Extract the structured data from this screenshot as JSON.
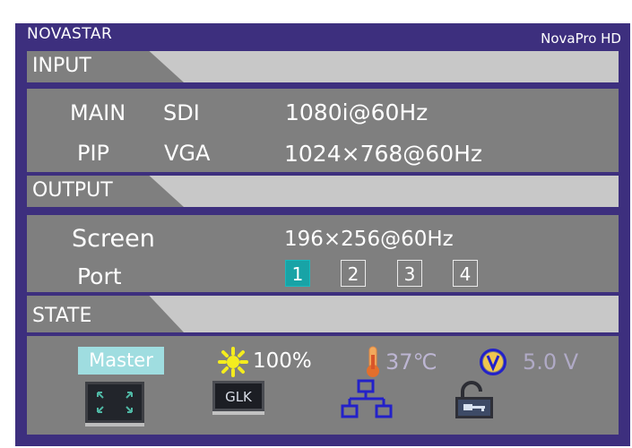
{
  "header": {
    "brand": "NOVASTAR",
    "model": "NovaPro HD"
  },
  "input": {
    "title": "INPUT",
    "main": {
      "label": "MAIN",
      "source": "SDI",
      "format": "1080i@60Hz"
    },
    "pip": {
      "label": "PIP",
      "source": "VGA",
      "format": "1024×768@60Hz"
    }
  },
  "output": {
    "title": "OUTPUT",
    "screen": {
      "label": "Screen",
      "value": "196×256@60Hz"
    },
    "port": {
      "label": "Port",
      "ports": [
        "1",
        "2",
        "3",
        "4"
      ],
      "active": "1"
    }
  },
  "state": {
    "title": "STATE",
    "role": "Master",
    "brightness": "100%",
    "temperature": "37℃",
    "voltage": "5.0 V"
  },
  "colors": {
    "frame": "#3d2f7e",
    "panel": "#7f7f7f",
    "section_bar": "#c8c8c8",
    "active_port": "#18a3a6",
    "master_badge": "#9fdde0",
    "icon_blue": "#2321c9",
    "sun_yellow": "#f4ec1e",
    "thermo_orange": "#f2a95c"
  },
  "icons": [
    "sun-icon",
    "thermometer-icon",
    "voltage-icon",
    "fullscreen-icon",
    "genlock-icon",
    "network-icon",
    "lock-icon"
  ]
}
